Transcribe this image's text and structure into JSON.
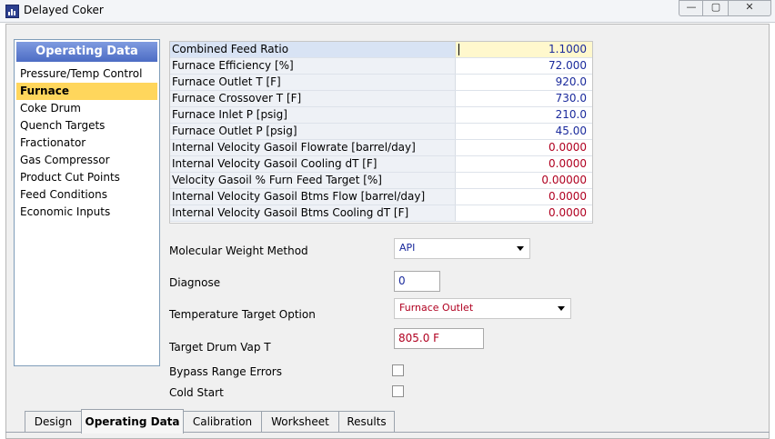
{
  "window": {
    "title": "Delayed Coker",
    "app_icon": "bar-chart-icon",
    "min_glyph": "—",
    "max_glyph": "▢",
    "close_glyph": "✕"
  },
  "sidebar": {
    "header": "Operating Data",
    "items": [
      {
        "label": "Pressure/Temp Control"
      },
      {
        "label": "Furnace",
        "selected": true
      },
      {
        "label": "Coke Drum"
      },
      {
        "label": "Quench Targets"
      },
      {
        "label": "Fractionator"
      },
      {
        "label": "Gas Compressor"
      },
      {
        "label": "Product Cut Points"
      },
      {
        "label": "Feed Conditions"
      },
      {
        "label": "Economic Inputs"
      }
    ]
  },
  "grid": {
    "rows": [
      {
        "label": "Combined Feed Ratio",
        "value": "1.1000"
      },
      {
        "label": "Furnace Efficiency [%]",
        "value": "72.000"
      },
      {
        "label": "Furnace Outlet T [F]",
        "value": "920.0"
      },
      {
        "label": "Furnace Crossover T [F]",
        "value": "730.0"
      },
      {
        "label": "Furnace Inlet P [psig]",
        "value": "210.0"
      },
      {
        "label": "Furnace Outlet P [psig]",
        "value": "45.00"
      },
      {
        "label": "Internal Velocity Gasoil Flowrate [barrel/day]",
        "value": "0.0000"
      },
      {
        "label": "Internal Velocity Gasoil Cooling dT [F]",
        "value": "0.0000"
      },
      {
        "label": "Velocity Gasoil % Furn Feed Target [%]",
        "value": "0.00000"
      },
      {
        "label": "Internal Velocity Gasoil Btms Flow [barrel/day]",
        "value": "0.0000"
      },
      {
        "label": "Internal Velocity Gasoil Btms Cooling dT [F]",
        "value": "0.0000"
      }
    ]
  },
  "form": {
    "mw_method_label": "Molecular Weight Method",
    "mw_method_value": "API",
    "diagnose_label": "Diagnose",
    "diagnose_value": "0",
    "temp_target_label": "Temperature Target Option",
    "temp_target_value": "Furnace Outlet",
    "drum_vap_label": "Target Drum Vap T",
    "drum_vap_value": "805.0 F",
    "bypass_label": "Bypass Range Errors",
    "bypass_checked": false,
    "cold_start_label": "Cold Start",
    "cold_start_checked": false
  },
  "tabs": [
    {
      "label": "Design"
    },
    {
      "label": "Operating Data",
      "active": true
    },
    {
      "label": "Calibration"
    },
    {
      "label": "Worksheet"
    },
    {
      "label": "Results"
    }
  ],
  "colors": {
    "selected_item": "#ffd65c",
    "value_blue": "#1a2a9c",
    "value_red": "#b00020",
    "header_blue": "#4c6cc4"
  }
}
